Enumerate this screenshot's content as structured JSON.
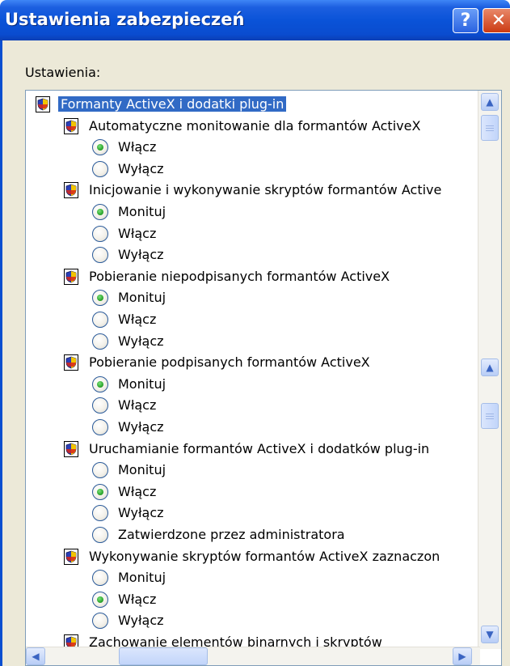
{
  "window": {
    "title": "Ustawienia zabezpieczeń",
    "help_glyph": "?",
    "close_glyph": "✕"
  },
  "settings_label": "Ustawienia:",
  "tree": {
    "root": "Formanty ActiveX i dodatki plug-in",
    "nodes": [
      {
        "label": "Automatyczne monitowanie dla formantów ActiveX",
        "options": [
          {
            "label": "Włącz",
            "checked": true
          },
          {
            "label": "Wyłącz",
            "checked": false
          }
        ]
      },
      {
        "label": "Inicjowanie i wykonywanie skryptów formantów Active",
        "options": [
          {
            "label": "Monituj",
            "checked": true
          },
          {
            "label": "Włącz",
            "checked": false
          },
          {
            "label": "Wyłącz",
            "checked": false
          }
        ]
      },
      {
        "label": "Pobieranie niepodpisanych formantów ActiveX",
        "options": [
          {
            "label": "Monituj",
            "checked": true
          },
          {
            "label": "Włącz",
            "checked": false
          },
          {
            "label": "Wyłącz",
            "checked": false
          }
        ]
      },
      {
        "label": "Pobieranie podpisanych formantów ActiveX",
        "options": [
          {
            "label": "Monituj",
            "checked": true
          },
          {
            "label": "Włącz",
            "checked": false
          },
          {
            "label": "Wyłącz",
            "checked": false
          }
        ]
      },
      {
        "label": "Uruchamianie formantów ActiveX i dodatków plug-in",
        "options": [
          {
            "label": "Monituj",
            "checked": false
          },
          {
            "label": "Włącz",
            "checked": true
          },
          {
            "label": "Wyłącz",
            "checked": false
          },
          {
            "label": "Zatwierdzone przez administratora",
            "checked": false
          }
        ]
      },
      {
        "label": "Wykonywanie skryptów formantów ActiveX zaznaczon",
        "options": [
          {
            "label": "Monituj",
            "checked": false
          },
          {
            "label": "Włącz",
            "checked": true
          },
          {
            "label": "Wyłącz",
            "checked": false
          }
        ]
      },
      {
        "label": "Zachowanie elementów binarnych i skryptów",
        "options": []
      }
    ]
  },
  "colors": {
    "selection": "#316ac5",
    "titlebar": "#0a53d8",
    "dialog_bg": "#ece9d8"
  },
  "icons": {
    "setting": "security-shield-icon",
    "scroll_up": "arrow-up-icon",
    "scroll_down": "arrow-down-icon",
    "scroll_left": "arrow-left-icon",
    "scroll_right": "arrow-right-icon"
  }
}
